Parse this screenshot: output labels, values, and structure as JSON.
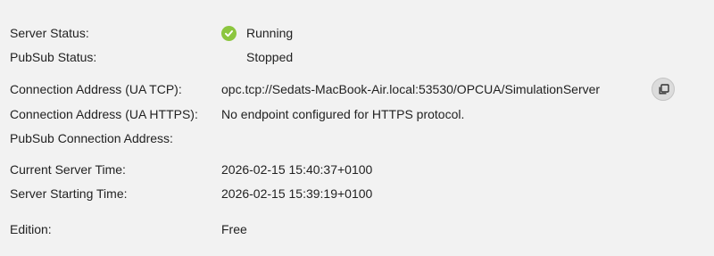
{
  "server_status": {
    "label": "Server Status:",
    "value": "Running",
    "icon": "check-circle-icon",
    "icon_color": "#8cc63f"
  },
  "pubsub_status": {
    "label": "PubSub Status:",
    "value": "Stopped"
  },
  "connection_tcp": {
    "label": "Connection Address (UA TCP):",
    "value": "opc.tcp://Sedats-MacBook-Air.local:53530/OPCUA/SimulationServer",
    "copy_icon": "copy-icon"
  },
  "connection_https": {
    "label": "Connection Address (UA HTTPS):",
    "value": "No endpoint configured for HTTPS protocol."
  },
  "pubsub_connection": {
    "label": "PubSub Connection Address:",
    "value": ""
  },
  "current_time": {
    "label": "Current Server Time:",
    "value": "2026-02-15 15:40:37+0100"
  },
  "start_time": {
    "label": "Server Starting Time:",
    "value": "2026-02-15 15:39:19+0100"
  },
  "edition": {
    "label": "Edition:",
    "value": "Free"
  }
}
